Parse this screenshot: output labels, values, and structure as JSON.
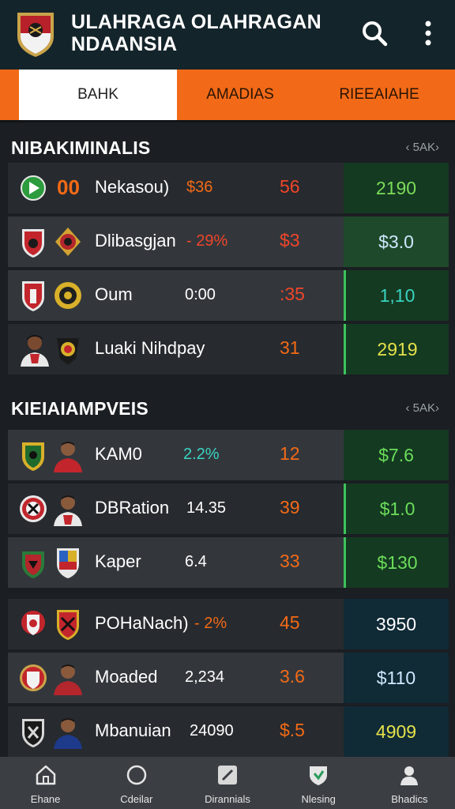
{
  "header": {
    "title_line1": "ULAHRAGA OLAHRAGAN",
    "title_line2": "NDAANSIA",
    "logo_icon": "shield-crest-icon",
    "search_icon": "search-icon",
    "more_icon": "more-vertical-icon"
  },
  "tabs": [
    {
      "label": "BAHK",
      "active": true
    },
    {
      "label": "AMADIAS",
      "active": false
    },
    {
      "label": "RIEEAIAHE",
      "active": false
    }
  ],
  "sections": [
    {
      "title": "NIBAKIMINALIS",
      "link": "‹ 5AK›",
      "rows": [
        {
          "name": "Nekasou)",
          "stat": "$36",
          "stat_prefix": "00",
          "score": "56",
          "odds": "2190",
          "stat_color": "#f26a17",
          "odds_color": "#7ddc5a"
        },
        {
          "name": "Dlibasgjan",
          "stat": "- 29%",
          "score": "$3",
          "odds": "$3.0",
          "stat_color": "#f0452a",
          "odds_color": "#cfe8ff"
        },
        {
          "name": "Oum",
          "stat": "0:00",
          "score": ":35",
          "odds": "1,10",
          "stat_color": "#ffffff",
          "odds_color": "#39d4c2"
        },
        {
          "name": "Luaki Nihdpay",
          "stat": "",
          "score": "31",
          "odds": "2919",
          "stat_color": "#ffffff",
          "odds_color": "#e5e24a"
        }
      ]
    },
    {
      "title": "KIEIAIAMPVEIS",
      "link": "‹ 5AK›",
      "rows": [
        {
          "name": "KAM0",
          "stat": "2.2%",
          "score": "12",
          "odds": "$7.6",
          "stat_color": "#39d4c2",
          "odds_color": "#6bdc5a"
        },
        {
          "name": "DBRation",
          "stat": "14.35",
          "score": "39",
          "odds": "$1.0",
          "stat_color": "#ffffff",
          "odds_color": "#6bdc5a"
        },
        {
          "name": "Kaper",
          "stat": "6.4",
          "score": "33",
          "odds": "$130",
          "stat_color": "#ffffff",
          "odds_color": "#6bdc5a"
        },
        {
          "name": "POHaNach)",
          "stat": "- 2%",
          "score": "45",
          "odds": "3950",
          "stat_color": "#f26a17",
          "odds_color": "#ffffff"
        },
        {
          "name": "Moaded",
          "stat": "2,234",
          "score": "3.6",
          "odds": "$110",
          "stat_color": "#ffffff",
          "odds_color": "#cfe8ff"
        },
        {
          "name": "Mbanuian",
          "stat": "24090",
          "score": "$.5",
          "odds": "4909",
          "stat_color": "#ffffff",
          "odds_color": "#e5e24a"
        }
      ]
    }
  ],
  "bottom_nav": [
    {
      "label": "Ehane",
      "icon": "home-icon"
    },
    {
      "label": "Cdeilar",
      "icon": "circle-icon"
    },
    {
      "label": "Dirannials",
      "icon": "edit-icon"
    },
    {
      "label": "Nlesing",
      "icon": "shield-icon"
    },
    {
      "label": "Bhadics",
      "icon": "profile-icon"
    }
  ],
  "colors": {
    "header_bg": "#14242b",
    "tab_bar": "#f26a17",
    "accent_green": "#3ec25a",
    "score_red": "#f0452a"
  }
}
